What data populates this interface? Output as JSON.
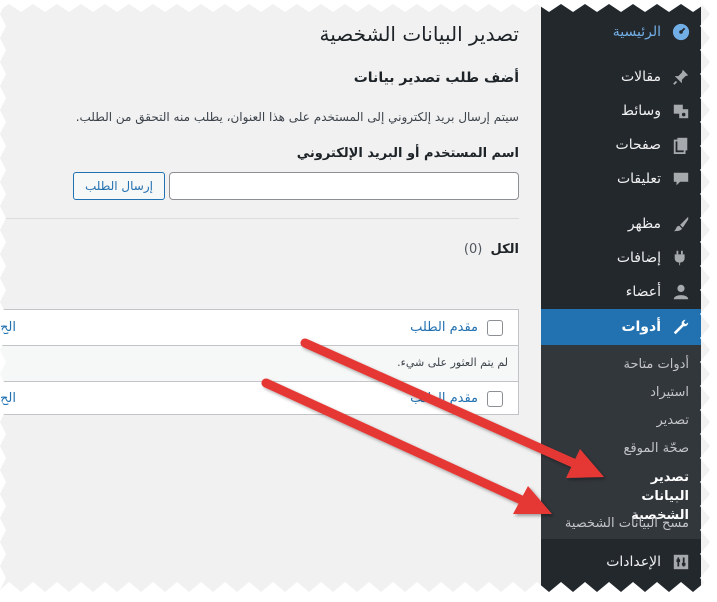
{
  "sidebar": {
    "items": [
      {
        "label": "الرئيسية",
        "icon": "dashboard-icon"
      },
      {
        "label": "مقالات",
        "icon": "pin-icon"
      },
      {
        "label": "وسائط",
        "icon": "media-icon"
      },
      {
        "label": "صفحات",
        "icon": "pages-icon"
      },
      {
        "label": "تعليقات",
        "icon": "comment-icon"
      },
      {
        "label": "مظهر",
        "icon": "brush-icon"
      },
      {
        "label": "إضافات",
        "icon": "plugin-icon"
      },
      {
        "label": "أعضاء",
        "icon": "users-icon"
      },
      {
        "label": "أدوات",
        "icon": "wrench-icon"
      },
      {
        "label": "الإعدادات",
        "icon": "settings-icon"
      }
    ],
    "submenu": [
      {
        "label": "أدوات متاحة"
      },
      {
        "label": "استيراد"
      },
      {
        "label": "تصدير"
      },
      {
        "label": "صحّة الموقع"
      },
      {
        "label": "تصدير البيانات الشخصية"
      },
      {
        "label": "مسح البيانات الشخصية"
      }
    ]
  },
  "main": {
    "title": "تصدير البيانات الشخصية",
    "section_title": "أضف طلب تصدير بيانات",
    "description": "سيتم إرسال بريد إلكتروني إلى المستخدم على هذا العنوان، يطلب منه التحقق من الطلب.",
    "field_label": "اسم المستخدم أو البريد الإلكتروني",
    "email_value": "",
    "send_button": "إرسال الطلب",
    "filter_all": "الكل",
    "filter_count": "(0)",
    "table": {
      "header_col": "مقدم الطلب",
      "header_col_cut": "الح",
      "empty_message": "لم يتم العثور على شيء.",
      "footer_col": "مقدم الطلب",
      "footer_col_cut": "الح"
    }
  },
  "colors": {
    "sidebar_bg": "#23282d",
    "active_bg": "#2271b1",
    "link": "#2271b1",
    "arrow": "#e53935"
  }
}
